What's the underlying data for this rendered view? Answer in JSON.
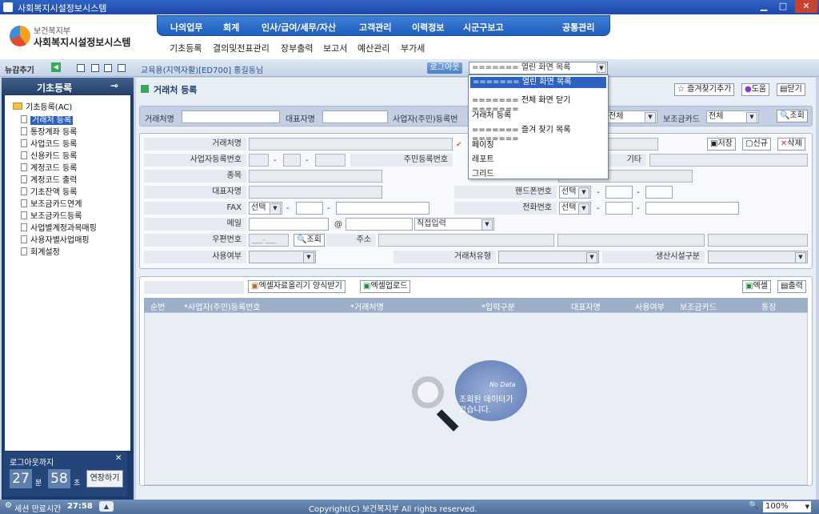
{
  "window": {
    "title": "사회복지시설정보시스템"
  },
  "logo": {
    "line1": "보건복지부",
    "line2": "사회복지시설정보시스템"
  },
  "main_nav": [
    "나의업무",
    "회계",
    "인사/급여/세무/자산",
    "고객관리",
    "이력정보",
    "시군구보고",
    "공통관리"
  ],
  "sub_nav": [
    "기초등록",
    "결의및전표관리",
    "장부출력",
    "보고서",
    "예산관리",
    "부가세"
  ],
  "toolbar": {
    "news_label": "뉴감추기",
    "user_info": "교육용(지역자활)[ED700] 홍길동님",
    "logout_label": "로그아웃",
    "open_screens_combo": "======= 열린 화면 목록 ======="
  },
  "dropdown": {
    "items": [
      "======= 열린 화면 목록 =======",
      "======= 전체 화면 닫기 =======",
      "거래처 등록",
      "======= 즐겨 찾기 목록 =======",
      "페이징",
      "레포트",
      "그리드"
    ],
    "selected_index": 0
  },
  "sidebar": {
    "title": "기초등록",
    "root": "기초등록(AC)",
    "items": [
      "거래처 등록",
      "통장계좌 등록",
      "사업코드 등록",
      "신용카드 등록",
      "계정코드 등록",
      "계정코드 출력",
      "기초잔액 등록",
      "보조금카드연계",
      "보조금카드등록",
      "사업별계정과목매핑",
      "사용자별사업매핑",
      "회계설정"
    ],
    "selected_index": 0
  },
  "logout_timer": {
    "label": "로그아웃까지",
    "minutes": "27",
    "min_unit": "분",
    "seconds": "58",
    "sec_unit": "초",
    "extend_label": "연장하기"
  },
  "page": {
    "title": "거래처 등록",
    "fav_label": "즐겨찾기추가",
    "help_label": "도움",
    "close_label": "닫기"
  },
  "search": {
    "name_label": "거래처명",
    "rep_label": "대표자명",
    "bizno_label": "사업자(주민)등록번",
    "all_value": "전체",
    "card_label": "보조금카드",
    "card_value": "전체",
    "search_label": "조회"
  },
  "form": {
    "name_label": "거래처명",
    "bizno_label": "사업자등록번호",
    "jumin_label": "주민등록번호",
    "etc_label": "기타",
    "type_label": "종목",
    "rep_label": "대표자명",
    "mobile_label": "핸드폰번호",
    "fax_label": "FAX",
    "phone_label": "전화번호",
    "mail_label": "메일",
    "at": "@",
    "mail_domain_value": "직접입력",
    "zip_label": "우편번호",
    "zip_placeholder": "___-___",
    "zip_search": "조회",
    "addr_label": "주소",
    "use_label": "사용여부",
    "vendor_type_label": "거래처유형",
    "facility_label": "생산시설구분",
    "select_value": "선택",
    "dash": "-",
    "save_label": "저장",
    "new_label": "신규",
    "delete_label": "삭제"
  },
  "grid": {
    "excel_template_label": "엑셀자료올리기 양식받기",
    "excel_upload_label": "엑셀업로드",
    "excel_label": "엑셀",
    "print_label": "출력",
    "columns": [
      "순번",
      "*사업자(주민)등록번호",
      "*거래처명",
      "*입력구분",
      "대표자명",
      "사용여부",
      "보조금카드",
      "통장"
    ],
    "no_data_en": "No Data",
    "no_data_ko1": "조회된 데이터가",
    "no_data_ko2": "없습니다."
  },
  "status": {
    "session_label": "세션 만료시간",
    "session_time": "27:58",
    "copyright": "Copyright(C) 보건복지부 All rights reserved.",
    "zoom": "100%"
  }
}
